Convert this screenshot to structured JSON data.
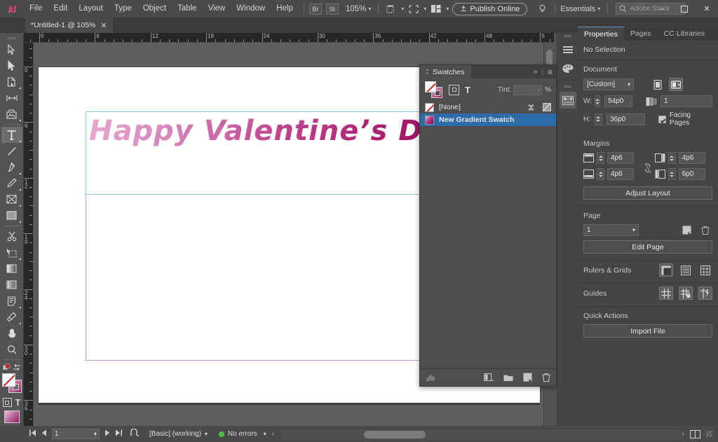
{
  "app": {
    "name": "Adobe InDesign",
    "logo_text": "Id",
    "accent_color": "#e8417f"
  },
  "menubar": {
    "items": [
      "File",
      "Edit",
      "Layout",
      "Type",
      "Object",
      "Table",
      "View",
      "Window",
      "Help"
    ],
    "bridge_label": "Br",
    "stock_label": "St",
    "zoom_level": "105%",
    "publish_label": "Publish Online",
    "workspace": "Essentials",
    "search_placeholder": "Adobe Stock",
    "window_minimize": "–",
    "window_maximize": "❐",
    "window_close": "✕"
  },
  "tabbar": {
    "document_tab": "*Untitled-1 @ 105%",
    "close_glyph": "✕"
  },
  "toolbar": {
    "tools": [
      {
        "name": "selection-tool",
        "selected": false
      },
      {
        "name": "direct-selection-tool",
        "selected": false
      },
      {
        "name": "page-tool",
        "selected": false
      },
      {
        "name": "gap-tool",
        "selected": false
      },
      {
        "name": "content-collector-tool",
        "selected": false
      },
      {
        "name": "type-tool",
        "selected": true
      },
      {
        "name": "line-tool",
        "selected": false
      },
      {
        "name": "pen-tool",
        "selected": false
      },
      {
        "name": "pencil-tool",
        "selected": false
      },
      {
        "name": "frame-tool",
        "selected": false
      },
      {
        "name": "rectangle-tool",
        "selected": false
      },
      {
        "name": "scissors-tool",
        "selected": false
      },
      {
        "name": "free-transform-tool",
        "selected": false
      },
      {
        "name": "gradient-swatch-tool",
        "selected": false
      },
      {
        "name": "gradient-feather-tool",
        "selected": false
      },
      {
        "name": "note-tool",
        "selected": false
      },
      {
        "name": "eyedropper-tool",
        "selected": false
      },
      {
        "name": "hand-tool",
        "selected": false
      },
      {
        "name": "zoom-tool",
        "selected": false
      }
    ]
  },
  "rulers": {
    "units": "picas",
    "horizontal_labels": [
      "0",
      "6",
      "12",
      "18",
      "24",
      "30",
      "36",
      "42",
      "48",
      "5"
    ],
    "vertical_labels": [
      "0",
      "6",
      "12",
      "18",
      "24",
      "30",
      "36"
    ]
  },
  "canvas": {
    "artboard_text": "Happy Valentine’s Day!",
    "text_gradient_start": "#e8a7cf",
    "text_gradient_end": "#8e1360",
    "margin_guide_color": "#e58fe8",
    "text_frame_color": "#8ec8ef"
  },
  "swatches_panel": {
    "title": "Swatches",
    "collapse_glyph": "»",
    "menu_glyph": "≡",
    "tint_label": "Tint:",
    "tint_value": "",
    "tint_unit": "%",
    "formatting_target_text": "T",
    "rows": [
      {
        "name": "[None]",
        "type": "none",
        "selected": false
      },
      {
        "name": "New Gradient Swatch",
        "type": "gradient",
        "selected": true
      }
    ],
    "footer_buttons": [
      "cc-library-icon",
      "show-swatch-groups-icon",
      "new-group-icon",
      "new-swatch-icon",
      "delete-swatch-icon"
    ]
  },
  "rail": {
    "buttons": [
      "paragraph-styles-icon",
      "color-icon",
      "color-theme-icon"
    ]
  },
  "properties": {
    "tabs": [
      {
        "label": "Properties",
        "active": true
      },
      {
        "label": "Pages",
        "active": false
      },
      {
        "label": "CC Libraries",
        "active": false
      }
    ],
    "selection_status": "No Selection",
    "document": {
      "heading": "Document",
      "preset": "[Custom]",
      "width_label": "W:",
      "width_value": "54p0",
      "height_label": "H:",
      "height_value": "36p0",
      "pages_value": "1",
      "facing_pages_label": "Facing Pages",
      "facing_pages_checked": true,
      "orientation_portrait": "portrait-icon",
      "orientation_landscape": "landscape-icon"
    },
    "margins": {
      "heading": "Margins",
      "top": "4p6",
      "bottom": "4p6",
      "inside": "4p6",
      "outside": "6p0",
      "link_icon": "chain-broken-icon",
      "adjust_layout_label": "Adjust Layout"
    },
    "page": {
      "heading": "Page",
      "current": "1",
      "edit_page_label": "Edit Page",
      "new_page_icon": "new-page-icon",
      "delete_page_icon": "trash-icon"
    },
    "rulers_grids": {
      "heading": "Rulers & Grids",
      "icons": [
        "show-rulers-icon",
        "baseline-grid-icon",
        "document-grid-icon"
      ]
    },
    "guides": {
      "heading": "Guides",
      "icons": [
        "show-guides-icon",
        "lock-guides-icon",
        "smart-guides-icon"
      ]
    },
    "quick_actions": {
      "heading": "Quick Actions",
      "import_file_label": "Import File"
    }
  },
  "statusbar": {
    "page_number": "1",
    "first_glyph": "⏮",
    "prev_glyph": "◀",
    "next_glyph": "▶",
    "last_glyph": "⏭",
    "style_name": "[Basic] (working)",
    "errors_text": "No errors",
    "errors_color": "#46c146",
    "next_chevron": "›",
    "prev_chevron": "‹"
  }
}
